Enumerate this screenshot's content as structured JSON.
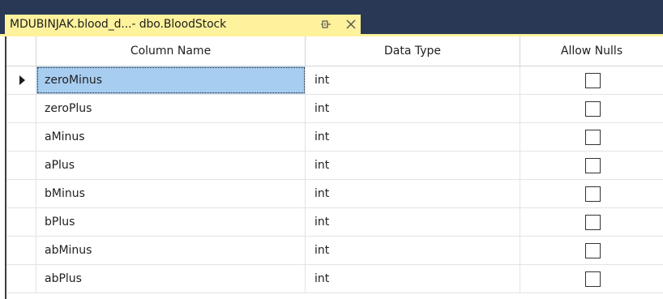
{
  "tab": {
    "title": "MDUBINJAK.blood_d...- dbo.BloodStock",
    "pin_glyph": "⸗",
    "close_glyph": "✕"
  },
  "colors": {
    "tabstrip": "#293955",
    "active_tab": "#fff29d",
    "selected_cell": "#a7cdf0"
  },
  "grid": {
    "headers": {
      "column_name": "Column Name",
      "data_type": "Data Type",
      "allow_nulls": "Allow Nulls"
    },
    "rows": [
      {
        "column_name": "zeroMinus",
        "data_type": "int",
        "allow_nulls": false,
        "current": true
      },
      {
        "column_name": "zeroPlus",
        "data_type": "int",
        "allow_nulls": false,
        "current": false
      },
      {
        "column_name": "aMinus",
        "data_type": "int",
        "allow_nulls": false,
        "current": false
      },
      {
        "column_name": "aPlus",
        "data_type": "int",
        "allow_nulls": false,
        "current": false
      },
      {
        "column_name": "bMinus",
        "data_type": "int",
        "allow_nulls": false,
        "current": false
      },
      {
        "column_name": "bPlus",
        "data_type": "int",
        "allow_nulls": false,
        "current": false
      },
      {
        "column_name": "abMinus",
        "data_type": "int",
        "allow_nulls": false,
        "current": false
      },
      {
        "column_name": "abPlus",
        "data_type": "int",
        "allow_nulls": false,
        "current": false
      }
    ]
  }
}
